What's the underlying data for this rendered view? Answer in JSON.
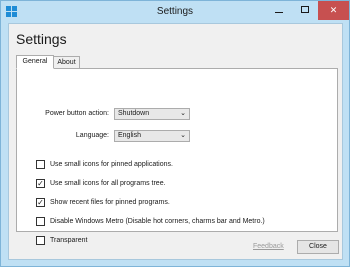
{
  "window": {
    "title": "Settings",
    "minimize_glyph": "",
    "close_glyph": "✕"
  },
  "heading": "Settings",
  "tabs": [
    {
      "label": "General",
      "selected": true
    },
    {
      "label": "About",
      "selected": false
    }
  ],
  "general": {
    "power_button": {
      "label": "Power button action:",
      "value": "Shutdown"
    },
    "language": {
      "label": "Language:",
      "value": "English"
    },
    "options": [
      {
        "label": "Use small icons for pinned applications.",
        "checked": false
      },
      {
        "label": "Use small icons for all programs tree.",
        "checked": true
      },
      {
        "label": "Show recent files for pinned programs.",
        "checked": true
      },
      {
        "label": "Disable Windows Metro (Disable hot corners, charms bar and Metro.)",
        "checked": false
      },
      {
        "label": "Transparent",
        "checked": false
      }
    ]
  },
  "footer": {
    "feedback_label": "Feedback",
    "close_label": "Close"
  },
  "colors": {
    "titlebar": "#bfe0f4",
    "close_button": "#c75050",
    "accent_icon": "#1e8cd6"
  }
}
